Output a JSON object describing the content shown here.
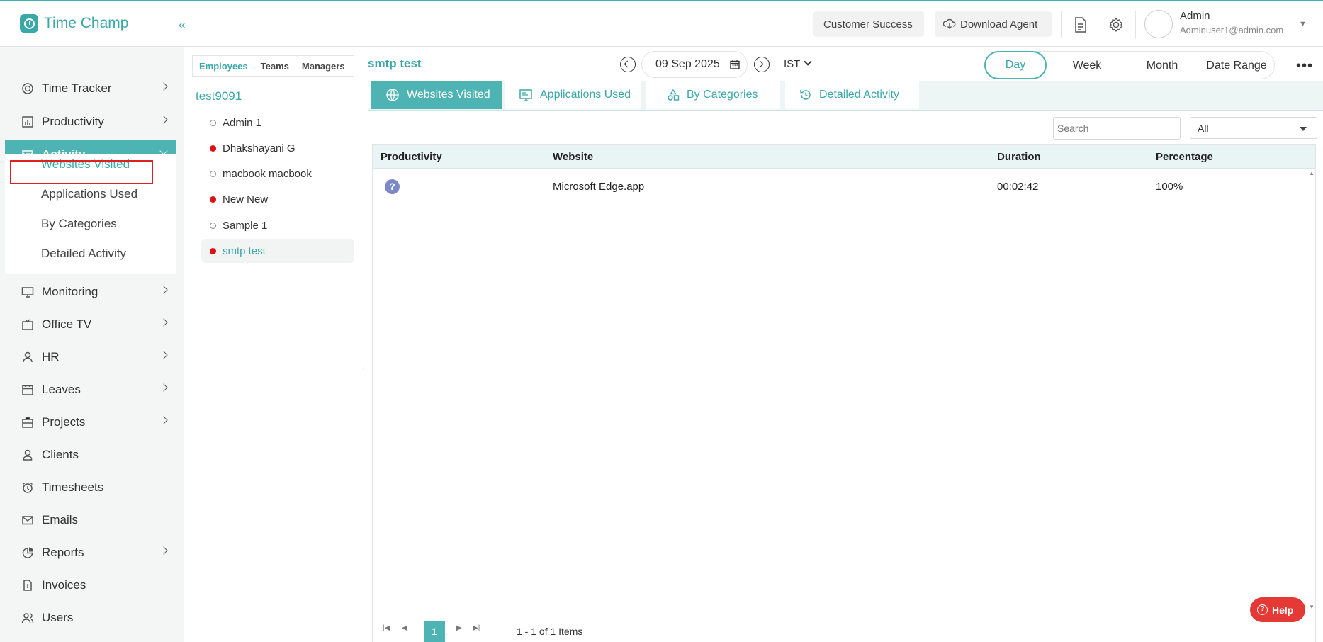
{
  "app": {
    "name": "Time Champ"
  },
  "header": {
    "customer_success": "Customer Success",
    "download_agent": "Download Agent",
    "user_name": "Admin",
    "user_email": "Adminuser1@admin.com"
  },
  "sidebar": {
    "items": [
      {
        "label": "Time Tracker",
        "icon": "clock-icon",
        "has_children": true
      },
      {
        "label": "Productivity",
        "icon": "bar-chart-icon",
        "has_children": true
      },
      {
        "label": "Activity",
        "icon": "ticket-icon",
        "has_children": true,
        "expanded": true
      },
      {
        "label": "Monitoring",
        "icon": "monitor-icon",
        "has_children": true
      },
      {
        "label": "Office TV",
        "icon": "tv-icon",
        "has_children": true
      },
      {
        "label": "HR",
        "icon": "user-icon",
        "has_children": true
      },
      {
        "label": "Leaves",
        "icon": "calendar-icon",
        "has_children": true
      },
      {
        "label": "Projects",
        "icon": "briefcase-icon",
        "has_children": true
      },
      {
        "label": "Clients",
        "icon": "client-icon",
        "has_children": false
      },
      {
        "label": "Timesheets",
        "icon": "alarm-icon",
        "has_children": false
      },
      {
        "label": "Emails",
        "icon": "mail-icon",
        "has_children": false
      },
      {
        "label": "Reports",
        "icon": "pie-chart-icon",
        "has_children": true
      },
      {
        "label": "Invoices",
        "icon": "invoice-icon",
        "has_children": false
      },
      {
        "label": "Users",
        "icon": "users-icon",
        "has_children": false
      }
    ],
    "activity_sub": [
      {
        "label": "Websites Visited",
        "active": true
      },
      {
        "label": "Applications Used",
        "active": false
      },
      {
        "label": "By Categories",
        "active": false
      },
      {
        "label": "Detailed Activity",
        "active": false
      }
    ]
  },
  "employees": {
    "tabs": [
      "Employees",
      "Teams",
      "Managers"
    ],
    "active_tab": "Employees",
    "team": "test9091",
    "list": [
      {
        "name": "Admin 1",
        "online": false
      },
      {
        "name": "Dhakshayani G",
        "online": true
      },
      {
        "name": "macbook macbook",
        "online": false
      },
      {
        "name": "New New",
        "online": true
      },
      {
        "name": "Sample 1",
        "online": false
      },
      {
        "name": "smtp test",
        "online": true,
        "selected": true
      }
    ]
  },
  "main": {
    "employee_title": "smtp test",
    "date": "09 Sep 2025",
    "timezone": "IST",
    "ranges": [
      "Day",
      "Week",
      "Month",
      "Date Range"
    ],
    "active_range": "Day",
    "tabs": [
      "Websites Visited",
      "Applications Used",
      "By Categories",
      "Detailed Activity"
    ],
    "active_tab": "Websites Visited",
    "search_placeholder": "Search",
    "filter_value": "All",
    "table": {
      "columns": [
        "Productivity",
        "Website",
        "Duration",
        "Percentage"
      ],
      "rows": [
        {
          "productivity_icon": "question-icon",
          "website": "Microsoft Edge.app",
          "duration": "00:02:42",
          "percentage": "100%"
        }
      ]
    },
    "pager": {
      "page": "1",
      "info": "1 - 1 of 1 Items"
    }
  },
  "help": {
    "label": "Help"
  },
  "colors": {
    "accent": "#4db3b3",
    "brand": "#3aa8a8",
    "highlight_box": "#e02020",
    "help": "#e53935"
  }
}
